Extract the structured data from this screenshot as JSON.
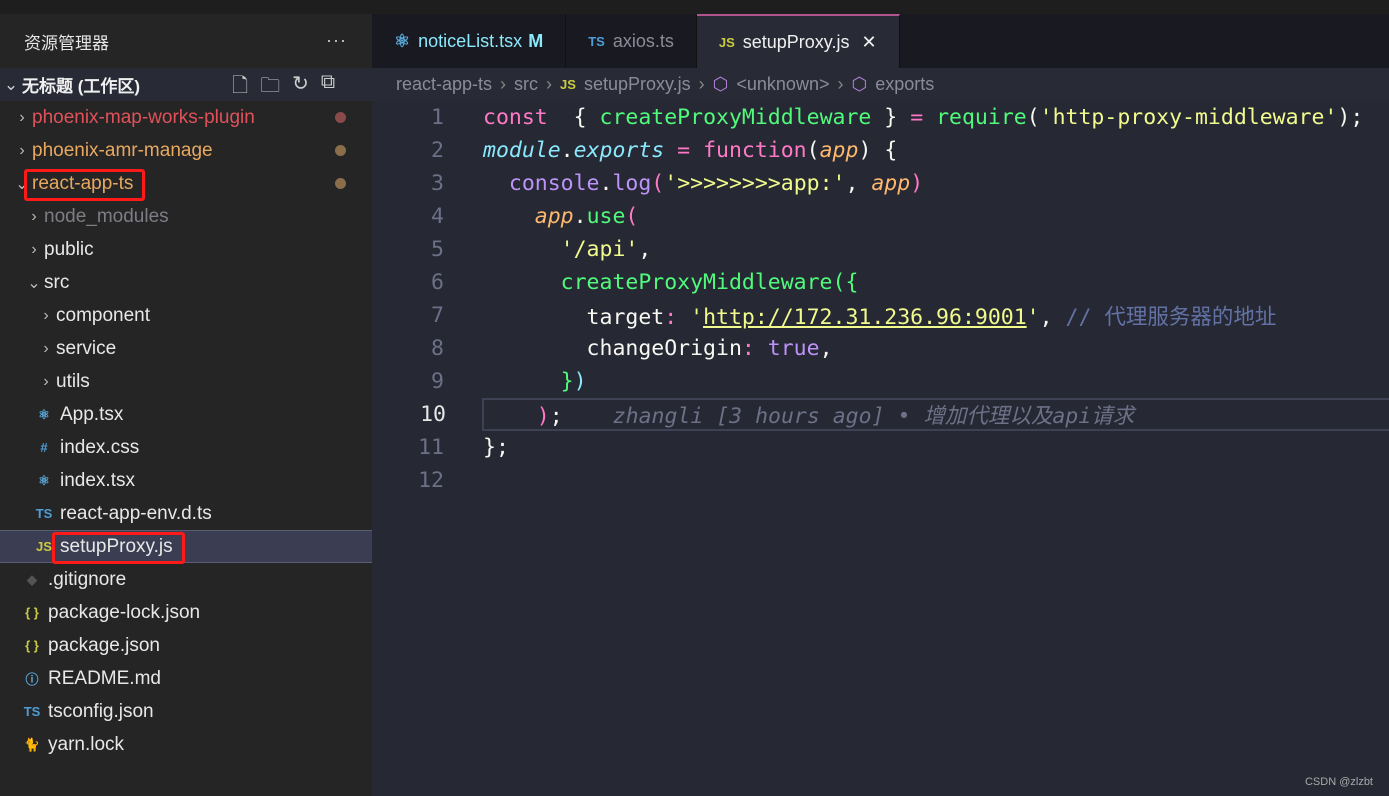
{
  "sidebar": {
    "title": "资源管理器",
    "more": "···",
    "workspace": "无标题 (工作区)",
    "tree": [
      {
        "label": "phoenix-map-works-plugin",
        "type": "folder",
        "open": false,
        "depth": 0,
        "color": "#e0525a",
        "dot": "#8a4a4a"
      },
      {
        "label": "phoenix-amr-manage",
        "type": "folder",
        "open": false,
        "depth": 0,
        "color": "#e8a860",
        "dot": "#8a6e4a"
      },
      {
        "label": "react-app-ts",
        "type": "folder",
        "open": true,
        "depth": 0,
        "color": "#e8a860",
        "dot": "#8a6e4a",
        "highlight": true
      },
      {
        "label": "node_modules",
        "type": "folder",
        "open": false,
        "depth": 1,
        "color": "#7d7d85"
      },
      {
        "label": "public",
        "type": "folder",
        "open": false,
        "depth": 1
      },
      {
        "label": "src",
        "type": "folder",
        "open": true,
        "depth": 1
      },
      {
        "label": "component",
        "type": "folder",
        "open": false,
        "depth": 2
      },
      {
        "label": "service",
        "type": "folder",
        "open": false,
        "depth": 2
      },
      {
        "label": "utils",
        "type": "folder",
        "open": false,
        "depth": 2
      },
      {
        "label": "App.tsx",
        "type": "file",
        "depth": 2,
        "icon": "⚛",
        "iconColor": "#5aa8d8"
      },
      {
        "label": "index.css",
        "type": "file",
        "depth": 2,
        "icon": "#",
        "iconColor": "#4e9ed6"
      },
      {
        "label": "index.tsx",
        "type": "file",
        "depth": 2,
        "icon": "⚛",
        "iconColor": "#5aa8d8"
      },
      {
        "label": "react-app-env.d.ts",
        "type": "file",
        "depth": 2,
        "icon": "TS",
        "iconColor": "#4e9ed6"
      },
      {
        "label": "setupProxy.js",
        "type": "file",
        "depth": 2,
        "icon": "JS",
        "iconColor": "#cbcb41",
        "selected": true,
        "highlight": true
      },
      {
        "label": ".gitignore",
        "type": "file",
        "depth": 1,
        "icon": "◆",
        "iconColor": "#555"
      },
      {
        "label": "package-lock.json",
        "type": "file",
        "depth": 1,
        "icon": "{ }",
        "iconColor": "#cbcb41"
      },
      {
        "label": "package.json",
        "type": "file",
        "depth": 1,
        "icon": "{ }",
        "iconColor": "#cbcb41"
      },
      {
        "label": "README.md",
        "type": "file",
        "depth": 1,
        "icon": "ⓘ",
        "iconColor": "#5aa8d8"
      },
      {
        "label": "tsconfig.json",
        "type": "file",
        "depth": 1,
        "icon": "TS",
        "iconColor": "#4e9ed6"
      },
      {
        "label": "yarn.lock",
        "type": "file",
        "depth": 1,
        "icon": "🐈",
        "iconColor": "#4e9ed6"
      }
    ]
  },
  "tabs": [
    {
      "label": "noticeList.tsx",
      "icon": "⚛",
      "iconColor": "#5aa8d8",
      "badge": "M",
      "color": "#8be9fd"
    },
    {
      "label": "axios.ts",
      "icon": "TS",
      "iconColor": "#4e9ed6"
    },
    {
      "label": "setupProxy.js",
      "icon": "JS",
      "iconColor": "#cbcb41",
      "active": true,
      "close": "✕"
    }
  ],
  "breadcrumb": [
    "react-app-ts",
    "src",
    "setupProxy.js",
    "<unknown>",
    "exports"
  ],
  "editor": {
    "current_line": 10,
    "lines": [
      [
        [
          "const",
          "k"
        ],
        [
          "  { ",
          "w"
        ],
        [
          "createProxyMiddleware",
          "g"
        ],
        [
          " } ",
          "w"
        ],
        [
          "=",
          "k"
        ],
        [
          " ",
          "w"
        ],
        [
          "require",
          "g"
        ],
        [
          "(",
          "w"
        ],
        [
          "'http-proxy-middleware'",
          "s"
        ],
        [
          ");",
          "w"
        ]
      ],
      [
        [
          "module",
          "c"
        ],
        [
          ".",
          "w"
        ],
        [
          "exports",
          "c"
        ],
        [
          " = ",
          "k"
        ],
        [
          "function",
          "k"
        ],
        [
          "(",
          "w"
        ],
        [
          "app",
          "o"
        ],
        [
          ") {",
          "w"
        ]
      ],
      [
        [
          "  console",
          "p"
        ],
        [
          ".",
          "w"
        ],
        [
          "log",
          "p"
        ],
        [
          "(",
          "k"
        ],
        [
          "'>>>>>>>>app:'",
          "s"
        ],
        [
          ", ",
          "w"
        ],
        [
          "app",
          "o"
        ],
        [
          ")",
          "k"
        ]
      ],
      [
        [
          "    app",
          "o"
        ],
        [
          ".",
          "w"
        ],
        [
          "use",
          "g"
        ],
        [
          "(",
          "k"
        ]
      ],
      [
        [
          "      '/api'",
          "s"
        ],
        [
          ",",
          "w"
        ]
      ],
      [
        [
          "      createProxyMiddleware",
          "g"
        ],
        [
          "({",
          "g"
        ]
      ],
      [
        [
          "        target",
          "w"
        ],
        [
          ": ",
          "k"
        ],
        [
          "'",
          "s"
        ],
        [
          "http://172.31.236.96:9001",
          "su"
        ],
        [
          "'",
          "s"
        ],
        [
          ", ",
          "w"
        ],
        [
          "// 代理服务器的地址",
          "cm"
        ]
      ],
      [
        [
          "        changeOrigin",
          "w"
        ],
        [
          ": ",
          "k"
        ],
        [
          "true",
          "p"
        ],
        [
          ",",
          "w"
        ]
      ],
      [
        [
          "      }",
          "g"
        ],
        [
          ")",
          "b"
        ]
      ],
      [
        [
          "    )",
          "k"
        ],
        [
          ";",
          "w"
        ]
      ],
      [
        [
          "};",
          "w"
        ]
      ],
      []
    ],
    "blame": "zhangli [3 hours ago] • 增加代理以及api请求"
  },
  "watermark": "CSDN @zlzbt"
}
